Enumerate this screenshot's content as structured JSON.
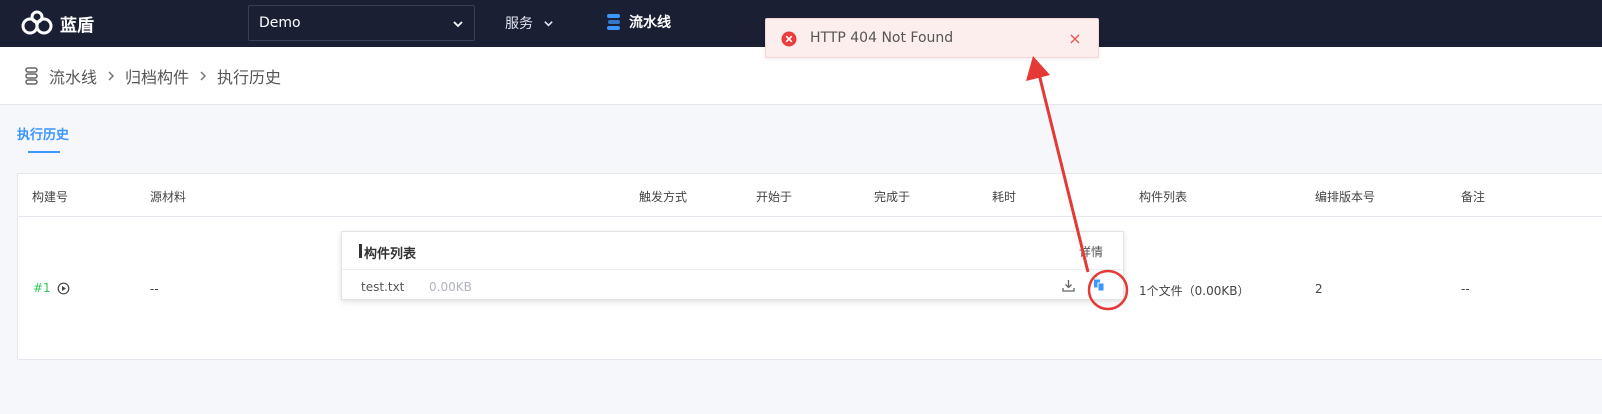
{
  "app": {
    "name": "蓝盾"
  },
  "topnav": {
    "project_selected": "Demo",
    "service_label": "服务",
    "pipeline_label": "流水线"
  },
  "breadcrumb": [
    "流水线",
    "归档构件",
    "执行历史"
  ],
  "tabs": [
    {
      "label": "执行历史",
      "active": true
    }
  ],
  "table": {
    "headers": [
      "构建号",
      "源材料",
      "触发方式",
      "开始于",
      "完成于",
      "耗时",
      "构件列表",
      "编排版本号",
      "备注"
    ],
    "row": {
      "build_no": "#1",
      "source": "--",
      "artifact_summary": "1个文件（0.00KB）",
      "version": "2",
      "remark": "--"
    }
  },
  "artifact_popover": {
    "title": "构件列表",
    "detail_link": "详情",
    "files": [
      {
        "name": "test.txt",
        "size": "0.00KB"
      }
    ]
  },
  "toast": {
    "message": "HTTP 404 Not Found",
    "close_glyph": "×"
  },
  "colors": {
    "topbar": "#1b1f33",
    "primary": "#3c96ff",
    "success": "#2dcb56",
    "error": "#ea5454",
    "annotation": "#e53935"
  },
  "icons": [
    "logo-icon",
    "chevron-down-icon",
    "pipeline-icon",
    "chevron-right-icon",
    "play-circle-icon",
    "download-icon",
    "copy-icon",
    "error-icon",
    "close-icon"
  ]
}
